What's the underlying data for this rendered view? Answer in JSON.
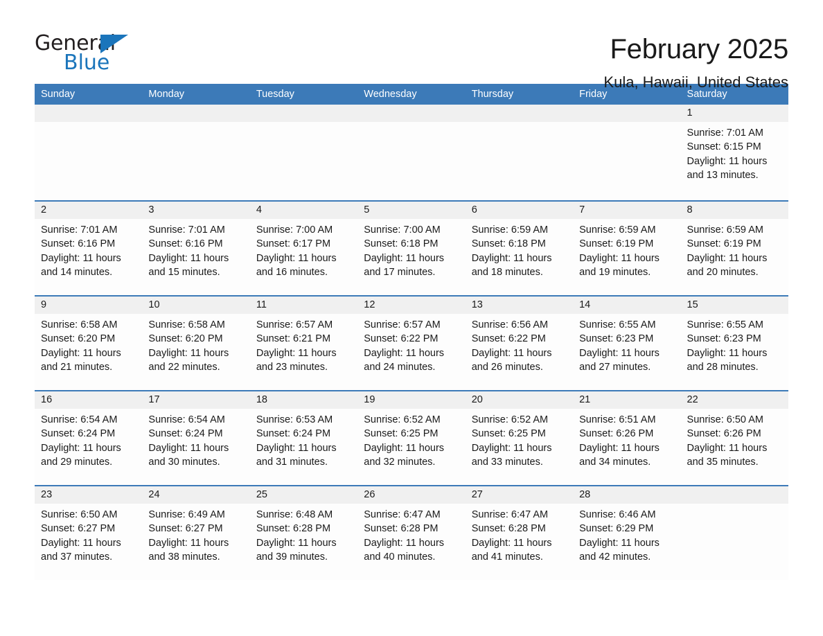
{
  "logo": {
    "word_one": "General",
    "word_two": "Blue",
    "triangle_icon": "blue-triangle-icon",
    "brand_color": "#1b75bb"
  },
  "header": {
    "month_title": "February 2025",
    "location": "Kula, Hawaii, United States"
  },
  "colors": {
    "header_blue": "#3c7ab8",
    "row_divider_blue": "#3c7ab8",
    "daynum_band": "#f0f0f0",
    "text": "#1a1a1a"
  },
  "calendar": {
    "weekday_headers": [
      "Sunday",
      "Monday",
      "Tuesday",
      "Wednesday",
      "Thursday",
      "Friday",
      "Saturday"
    ],
    "weeks": [
      {
        "days": [
          {
            "number": "",
            "lines": []
          },
          {
            "number": "",
            "lines": []
          },
          {
            "number": "",
            "lines": []
          },
          {
            "number": "",
            "lines": []
          },
          {
            "number": "",
            "lines": []
          },
          {
            "number": "",
            "lines": []
          },
          {
            "number": "1",
            "lines": [
              "Sunrise: 7:01 AM",
              "Sunset: 6:15 PM",
              "Daylight: 11 hours",
              "and 13 minutes."
            ]
          }
        ]
      },
      {
        "days": [
          {
            "number": "2",
            "lines": [
              "Sunrise: 7:01 AM",
              "Sunset: 6:16 PM",
              "Daylight: 11 hours",
              "and 14 minutes."
            ]
          },
          {
            "number": "3",
            "lines": [
              "Sunrise: 7:01 AM",
              "Sunset: 6:16 PM",
              "Daylight: 11 hours",
              "and 15 minutes."
            ]
          },
          {
            "number": "4",
            "lines": [
              "Sunrise: 7:00 AM",
              "Sunset: 6:17 PM",
              "Daylight: 11 hours",
              "and 16 minutes."
            ]
          },
          {
            "number": "5",
            "lines": [
              "Sunrise: 7:00 AM",
              "Sunset: 6:18 PM",
              "Daylight: 11 hours",
              "and 17 minutes."
            ]
          },
          {
            "number": "6",
            "lines": [
              "Sunrise: 6:59 AM",
              "Sunset: 6:18 PM",
              "Daylight: 11 hours",
              "and 18 minutes."
            ]
          },
          {
            "number": "7",
            "lines": [
              "Sunrise: 6:59 AM",
              "Sunset: 6:19 PM",
              "Daylight: 11 hours",
              "and 19 minutes."
            ]
          },
          {
            "number": "8",
            "lines": [
              "Sunrise: 6:59 AM",
              "Sunset: 6:19 PM",
              "Daylight: 11 hours",
              "and 20 minutes."
            ]
          }
        ]
      },
      {
        "days": [
          {
            "number": "9",
            "lines": [
              "Sunrise: 6:58 AM",
              "Sunset: 6:20 PM",
              "Daylight: 11 hours",
              "and 21 minutes."
            ]
          },
          {
            "number": "10",
            "lines": [
              "Sunrise: 6:58 AM",
              "Sunset: 6:20 PM",
              "Daylight: 11 hours",
              "and 22 minutes."
            ]
          },
          {
            "number": "11",
            "lines": [
              "Sunrise: 6:57 AM",
              "Sunset: 6:21 PM",
              "Daylight: 11 hours",
              "and 23 minutes."
            ]
          },
          {
            "number": "12",
            "lines": [
              "Sunrise: 6:57 AM",
              "Sunset: 6:22 PM",
              "Daylight: 11 hours",
              "and 24 minutes."
            ]
          },
          {
            "number": "13",
            "lines": [
              "Sunrise: 6:56 AM",
              "Sunset: 6:22 PM",
              "Daylight: 11 hours",
              "and 26 minutes."
            ]
          },
          {
            "number": "14",
            "lines": [
              "Sunrise: 6:55 AM",
              "Sunset: 6:23 PM",
              "Daylight: 11 hours",
              "and 27 minutes."
            ]
          },
          {
            "number": "15",
            "lines": [
              "Sunrise: 6:55 AM",
              "Sunset: 6:23 PM",
              "Daylight: 11 hours",
              "and 28 minutes."
            ]
          }
        ]
      },
      {
        "days": [
          {
            "number": "16",
            "lines": [
              "Sunrise: 6:54 AM",
              "Sunset: 6:24 PM",
              "Daylight: 11 hours",
              "and 29 minutes."
            ]
          },
          {
            "number": "17",
            "lines": [
              "Sunrise: 6:54 AM",
              "Sunset: 6:24 PM",
              "Daylight: 11 hours",
              "and 30 minutes."
            ]
          },
          {
            "number": "18",
            "lines": [
              "Sunrise: 6:53 AM",
              "Sunset: 6:24 PM",
              "Daylight: 11 hours",
              "and 31 minutes."
            ]
          },
          {
            "number": "19",
            "lines": [
              "Sunrise: 6:52 AM",
              "Sunset: 6:25 PM",
              "Daylight: 11 hours",
              "and 32 minutes."
            ]
          },
          {
            "number": "20",
            "lines": [
              "Sunrise: 6:52 AM",
              "Sunset: 6:25 PM",
              "Daylight: 11 hours",
              "and 33 minutes."
            ]
          },
          {
            "number": "21",
            "lines": [
              "Sunrise: 6:51 AM",
              "Sunset: 6:26 PM",
              "Daylight: 11 hours",
              "and 34 minutes."
            ]
          },
          {
            "number": "22",
            "lines": [
              "Sunrise: 6:50 AM",
              "Sunset: 6:26 PM",
              "Daylight: 11 hours",
              "and 35 minutes."
            ]
          }
        ]
      },
      {
        "days": [
          {
            "number": "23",
            "lines": [
              "Sunrise: 6:50 AM",
              "Sunset: 6:27 PM",
              "Daylight: 11 hours",
              "and 37 minutes."
            ]
          },
          {
            "number": "24",
            "lines": [
              "Sunrise: 6:49 AM",
              "Sunset: 6:27 PM",
              "Daylight: 11 hours",
              "and 38 minutes."
            ]
          },
          {
            "number": "25",
            "lines": [
              "Sunrise: 6:48 AM",
              "Sunset: 6:28 PM",
              "Daylight: 11 hours",
              "and 39 minutes."
            ]
          },
          {
            "number": "26",
            "lines": [
              "Sunrise: 6:47 AM",
              "Sunset: 6:28 PM",
              "Daylight: 11 hours",
              "and 40 minutes."
            ]
          },
          {
            "number": "27",
            "lines": [
              "Sunrise: 6:47 AM",
              "Sunset: 6:28 PM",
              "Daylight: 11 hours",
              "and 41 minutes."
            ]
          },
          {
            "number": "28",
            "lines": [
              "Sunrise: 6:46 AM",
              "Sunset: 6:29 PM",
              "Daylight: 11 hours",
              "and 42 minutes."
            ]
          },
          {
            "number": "",
            "lines": []
          }
        ]
      }
    ]
  }
}
